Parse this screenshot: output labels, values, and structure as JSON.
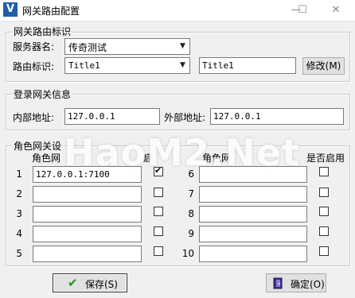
{
  "window": {
    "title": "网关路由配置",
    "app_icon_letter": "V",
    "minimize": "—",
    "maximize": "☐",
    "close": "✕"
  },
  "route_group": {
    "title": "网关路由标识",
    "server_label": "服务器名:",
    "server_value": "传奇测试",
    "route_label": "路由标识:",
    "route_value": "Title1",
    "route_text": "Title1",
    "modify_button": "修改(M)"
  },
  "login_group": {
    "title": "登录网关信息",
    "internal_label": "内部地址:",
    "internal_value": "127.0.0.1",
    "external_label": "外部地址:",
    "external_value": "127.0.0.1"
  },
  "role_group": {
    "title": "角色网关设",
    "left_header": "角色网",
    "left_header_tail": "启",
    "right_header": "角色网",
    "enable_header": "是否启用",
    "rows": [
      {
        "num": "1",
        "value": "127.0.0.1:7100",
        "checked": true
      },
      {
        "num": "2",
        "value": "",
        "checked": false
      },
      {
        "num": "3",
        "value": "",
        "checked": false
      },
      {
        "num": "4",
        "value": "",
        "checked": false
      },
      {
        "num": "5",
        "value": "",
        "checked": false
      },
      {
        "num": "6",
        "value": "",
        "checked": false
      },
      {
        "num": "7",
        "value": "",
        "checked": false
      },
      {
        "num": "8",
        "value": "",
        "checked": false
      },
      {
        "num": "9",
        "value": "",
        "checked": false
      },
      {
        "num": "10",
        "value": "",
        "checked": false
      }
    ]
  },
  "watermark": "HaoM2.Net",
  "footer": {
    "save_button": "保存(S)",
    "ok_button": "确定(O)"
  },
  "icons": {
    "save": "check-icon",
    "ok": "exit-door-icon"
  }
}
